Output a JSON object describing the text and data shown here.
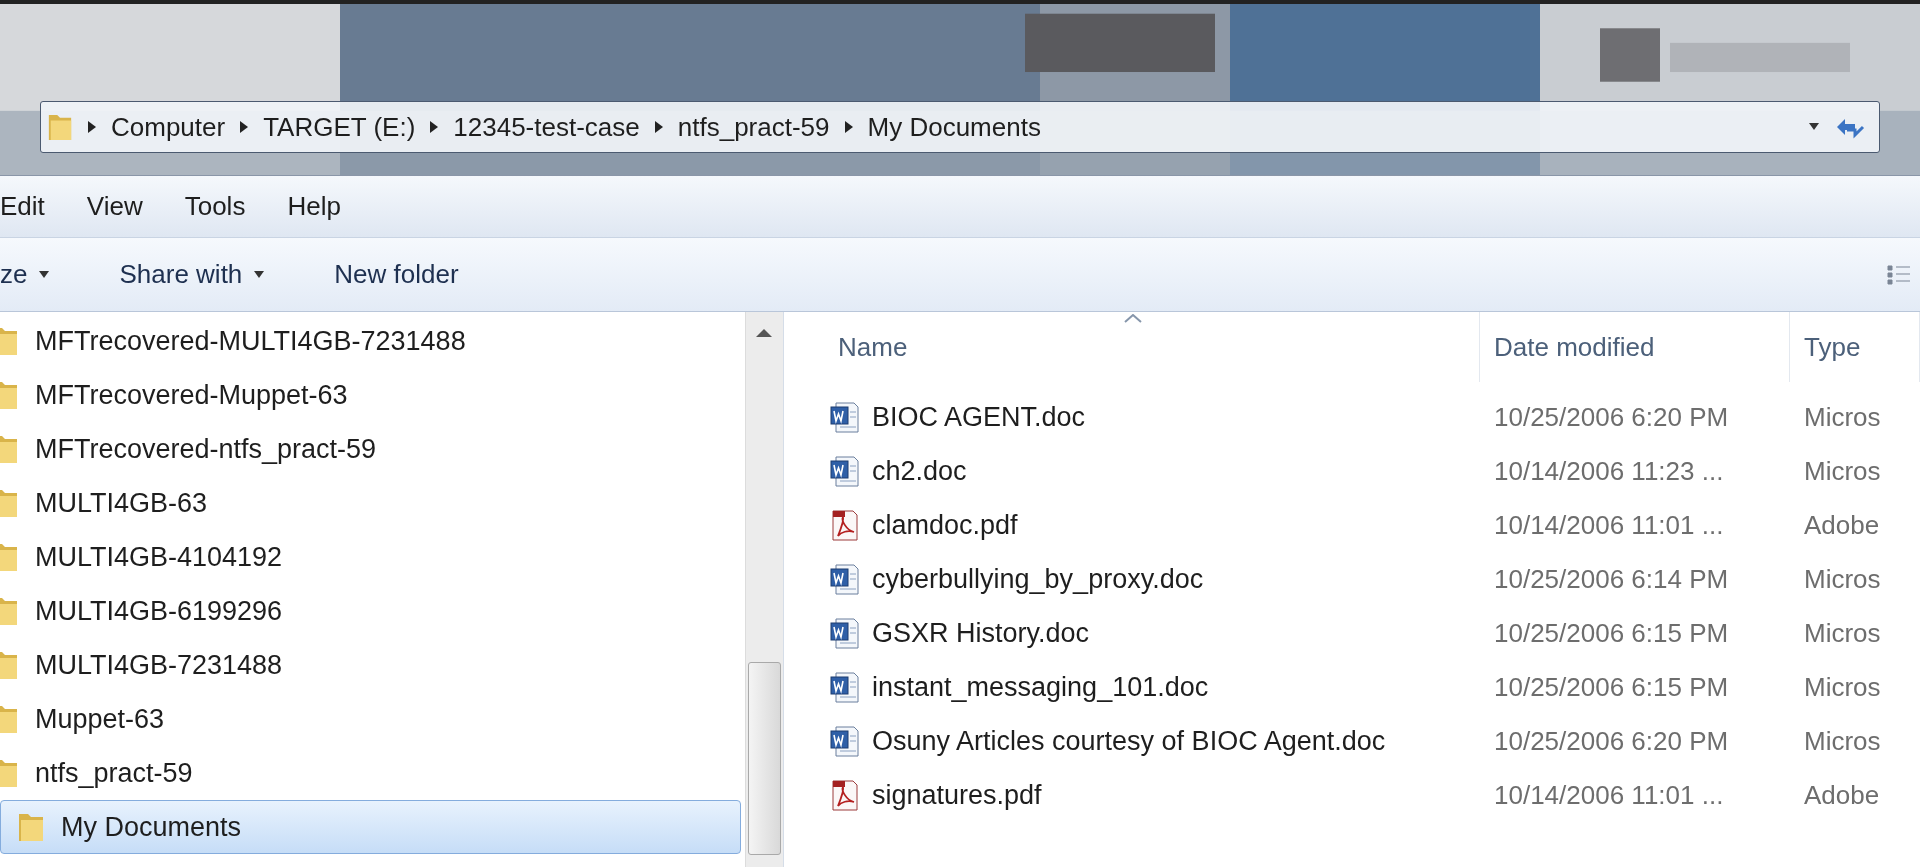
{
  "address_bar": {
    "crumbs": [
      "Computer",
      "TARGET (E:)",
      "12345-test-case",
      "ntfs_pract-59",
      "My Documents"
    ]
  },
  "menu": [
    "Edit",
    "View",
    "Tools",
    "Help"
  ],
  "toolbar": [
    {
      "label": "ze",
      "dropdown": true
    },
    {
      "label": "Share with",
      "dropdown": true
    },
    {
      "label": "New folder",
      "dropdown": false
    }
  ],
  "nav": [
    {
      "label": "MFTrecovered-MULTI4GB-7231488",
      "selected": false
    },
    {
      "label": "MFTrecovered-Muppet-63",
      "selected": false
    },
    {
      "label": "MFTrecovered-ntfs_pract-59",
      "selected": false
    },
    {
      "label": "MULTI4GB-63",
      "selected": false
    },
    {
      "label": "MULTI4GB-4104192",
      "selected": false
    },
    {
      "label": "MULTI4GB-6199296",
      "selected": false
    },
    {
      "label": "MULTI4GB-7231488",
      "selected": false
    },
    {
      "label": "Muppet-63",
      "selected": false
    },
    {
      "label": "ntfs_pract-59",
      "selected": false,
      "children": [
        {
          "label": "My Documents",
          "selected": true
        }
      ]
    }
  ],
  "columns": [
    {
      "label": "Name",
      "sorted": true
    },
    {
      "label": "Date modified",
      "sorted": false
    },
    {
      "label": "Type",
      "sorted": false
    }
  ],
  "files": [
    {
      "kind": "word",
      "name": "BIOC AGENT.doc",
      "date": "10/25/2006 6:20 PM",
      "type": "Micros"
    },
    {
      "kind": "word",
      "name": "ch2.doc",
      "date": "10/14/2006 11:23 ...",
      "type": "Micros"
    },
    {
      "kind": "pdf",
      "name": "clamdoc.pdf",
      "date": "10/14/2006 11:01 ...",
      "type": "Adobe"
    },
    {
      "kind": "word",
      "name": "cyberbullying_by_proxy.doc",
      "date": "10/25/2006 6:14 PM",
      "type": "Micros"
    },
    {
      "kind": "word",
      "name": "GSXR History.doc",
      "date": "10/25/2006 6:15 PM",
      "type": "Micros"
    },
    {
      "kind": "word",
      "name": "instant_messaging_101.doc",
      "date": "10/25/2006 6:15 PM",
      "type": "Micros"
    },
    {
      "kind": "word",
      "name": "Osuny Articles courtesy of BIOC Agent.doc",
      "date": "10/25/2006 6:20 PM",
      "type": "Micros"
    },
    {
      "kind": "pdf",
      "name": "signatures.pdf",
      "date": "10/14/2006 11:01 ...",
      "type": "Adobe"
    }
  ]
}
